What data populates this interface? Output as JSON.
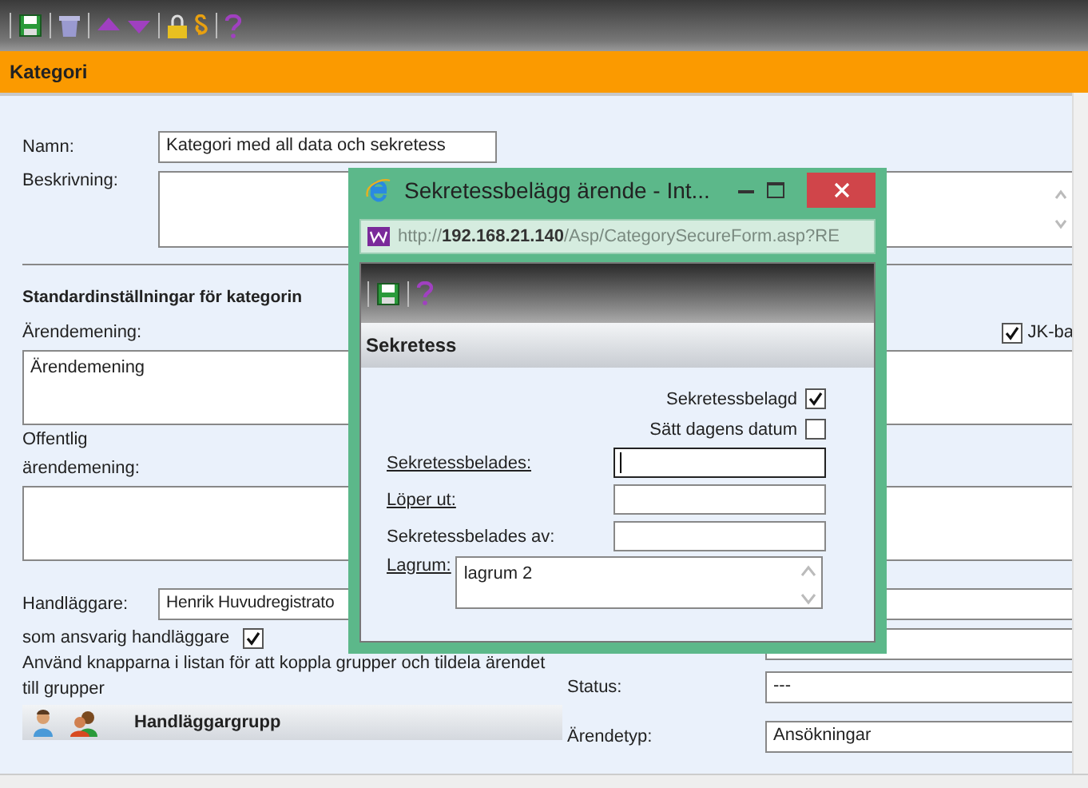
{
  "page_header": {
    "title": "Kategori"
  },
  "form": {
    "name_label": "Namn:",
    "name_value": "Kategori med all data och sekretess",
    "description_label": "Beskrivning:",
    "section_title": "Standardinställningar för kategorin",
    "case_meaning_label": "Ärendemening:",
    "jk_checkbox": {
      "label": "JK-ba",
      "checked": true
    },
    "case_meaning_value": "Ärendemening",
    "public_meaning_label_1": "Offentlig",
    "public_meaning_label_2": "ärendemening:",
    "handler_label": "Handläggare:",
    "handler_value": "Henrik Huvudregistrato",
    "responsible": {
      "label": "som ansvarig handläggare",
      "checked": true
    },
    "instructions": "Använd knapparna i listan för att koppla grupper och tildela ärendet till grupper",
    "group_column": "Handläggargrupp",
    "status_label": "Status:",
    "status_value": "---",
    "case_type_label": "Ärendetyp:",
    "case_type_value": "Ansökningar"
  },
  "popup": {
    "title": "Sekretessbelägg ärende - Int...",
    "url": "http://**192.168.21.140**/Asp/CategorySecureForm.asp?RE",
    "header": "Sekretess",
    "checks": [
      {
        "label": "Sekretessbelagd",
        "checked": true
      },
      {
        "label": "Sätt dagens datum",
        "checked": false
      }
    ],
    "fields": [
      {
        "label": "Sekretessbelades:",
        "underlined": true,
        "focused": true
      },
      {
        "label": "Löper ut:",
        "underlined": true,
        "focused": false
      },
      {
        "label": "Sekretessbelades av:",
        "underlined": false,
        "focused": false
      }
    ],
    "lagrum_label": "Lagrum:",
    "lagrum_value": "lagrum 2"
  }
}
